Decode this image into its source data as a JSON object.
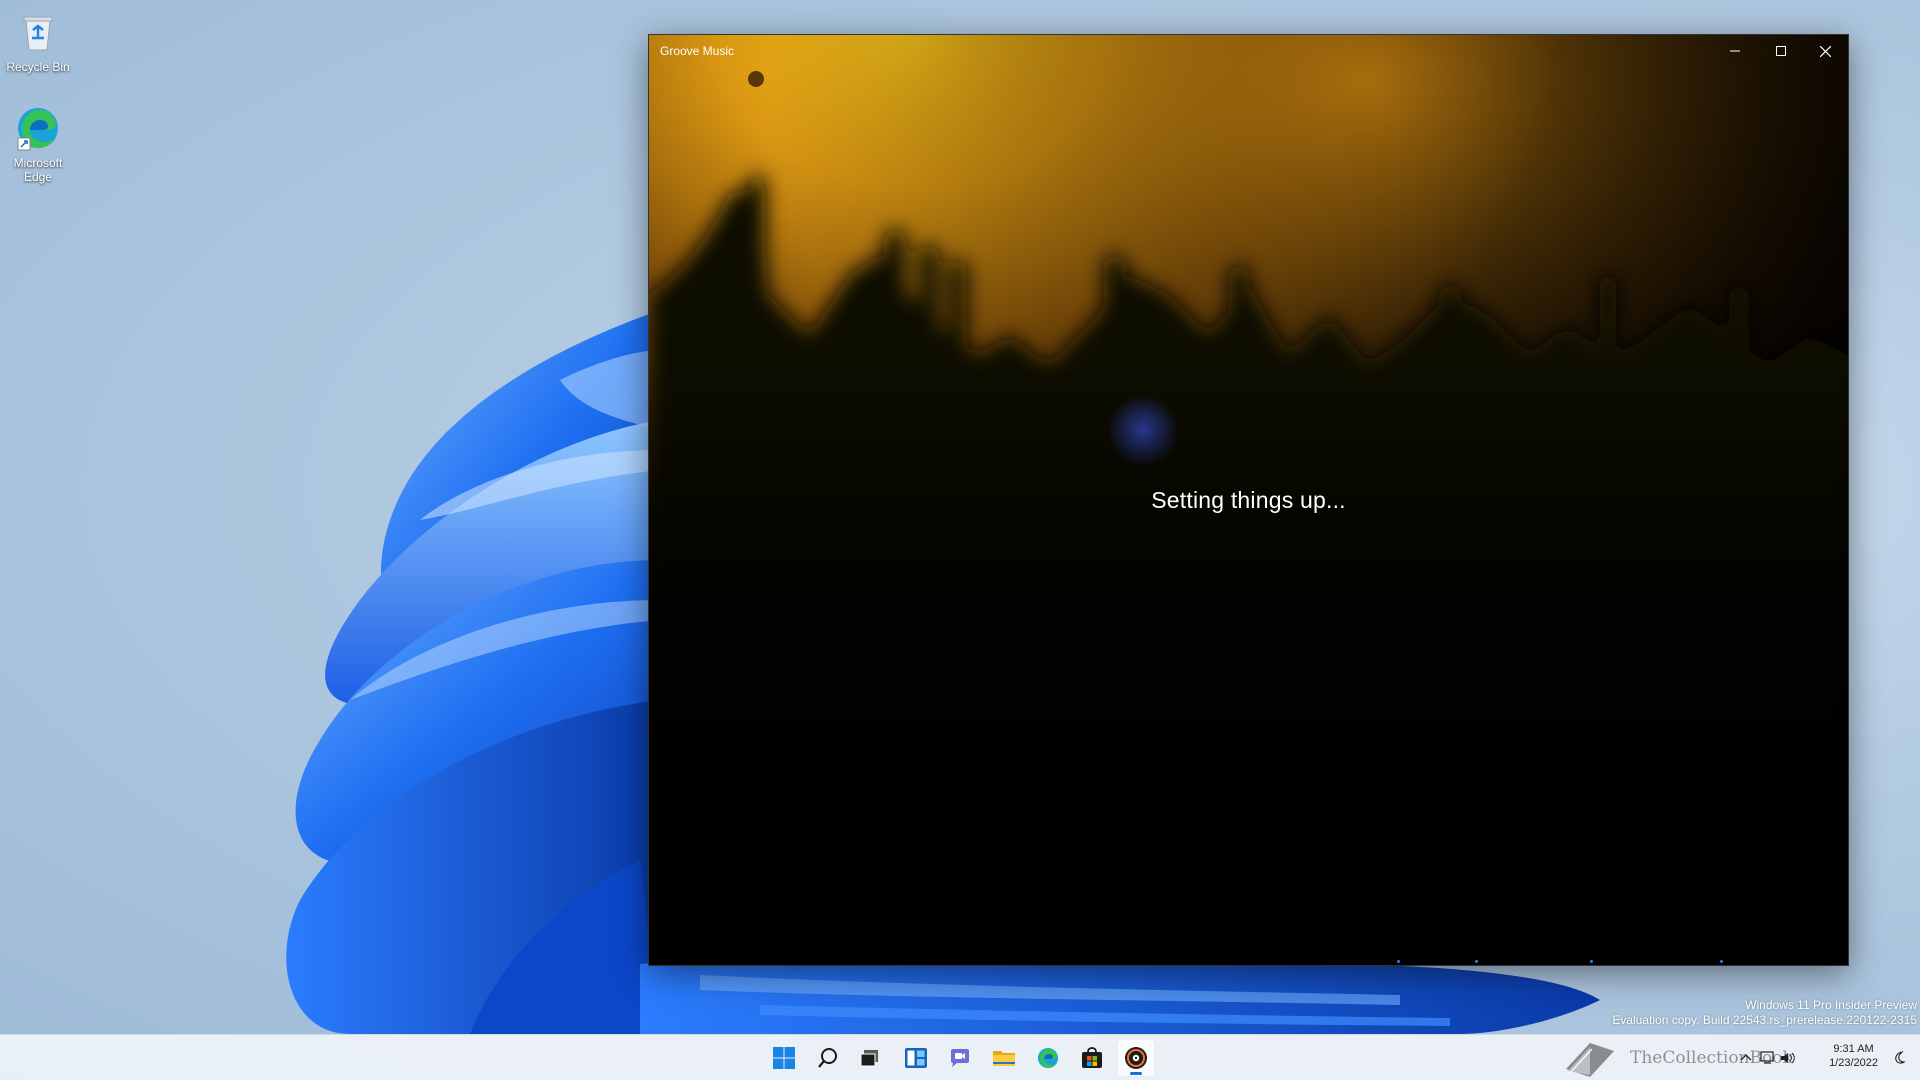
{
  "desktop": {
    "icons": [
      {
        "label": "Recycle Bin",
        "icon": "recycle-bin-icon"
      },
      {
        "label": "Microsoft Edge",
        "icon": "edge-icon"
      }
    ],
    "watermark": {
      "line1": "Windows 11 Pro Insider Preview",
      "line2": "Evaluation copy. Build 22543.rs_prerelease.220122-2315"
    }
  },
  "window": {
    "title": "Groove Music",
    "loading_text": "Setting things up...",
    "controls": {
      "minimize": "minimize-icon",
      "maximize": "maximize-icon",
      "close": "close-icon"
    }
  },
  "taskbar": {
    "apps": [
      {
        "name": "start",
        "icon": "windows-logo-icon"
      },
      {
        "name": "search",
        "icon": "search-icon"
      },
      {
        "name": "task-view",
        "icon": "task-view-icon"
      },
      {
        "name": "widgets",
        "icon": "widgets-icon"
      },
      {
        "name": "chat",
        "icon": "chat-icon"
      },
      {
        "name": "file-explorer",
        "icon": "folder-icon"
      },
      {
        "name": "edge",
        "icon": "edge-icon"
      },
      {
        "name": "store",
        "icon": "store-icon"
      },
      {
        "name": "groove-music",
        "icon": "groove-music-icon",
        "active": true
      }
    ],
    "tray": {
      "brand": "TheCollectionBook",
      "time": "9:31 AM",
      "date": "1/23/2022"
    }
  },
  "colors": {
    "accent": "#1a6fd8",
    "window_bg": "#000000",
    "bloom_blue": "#1f6ff2"
  }
}
